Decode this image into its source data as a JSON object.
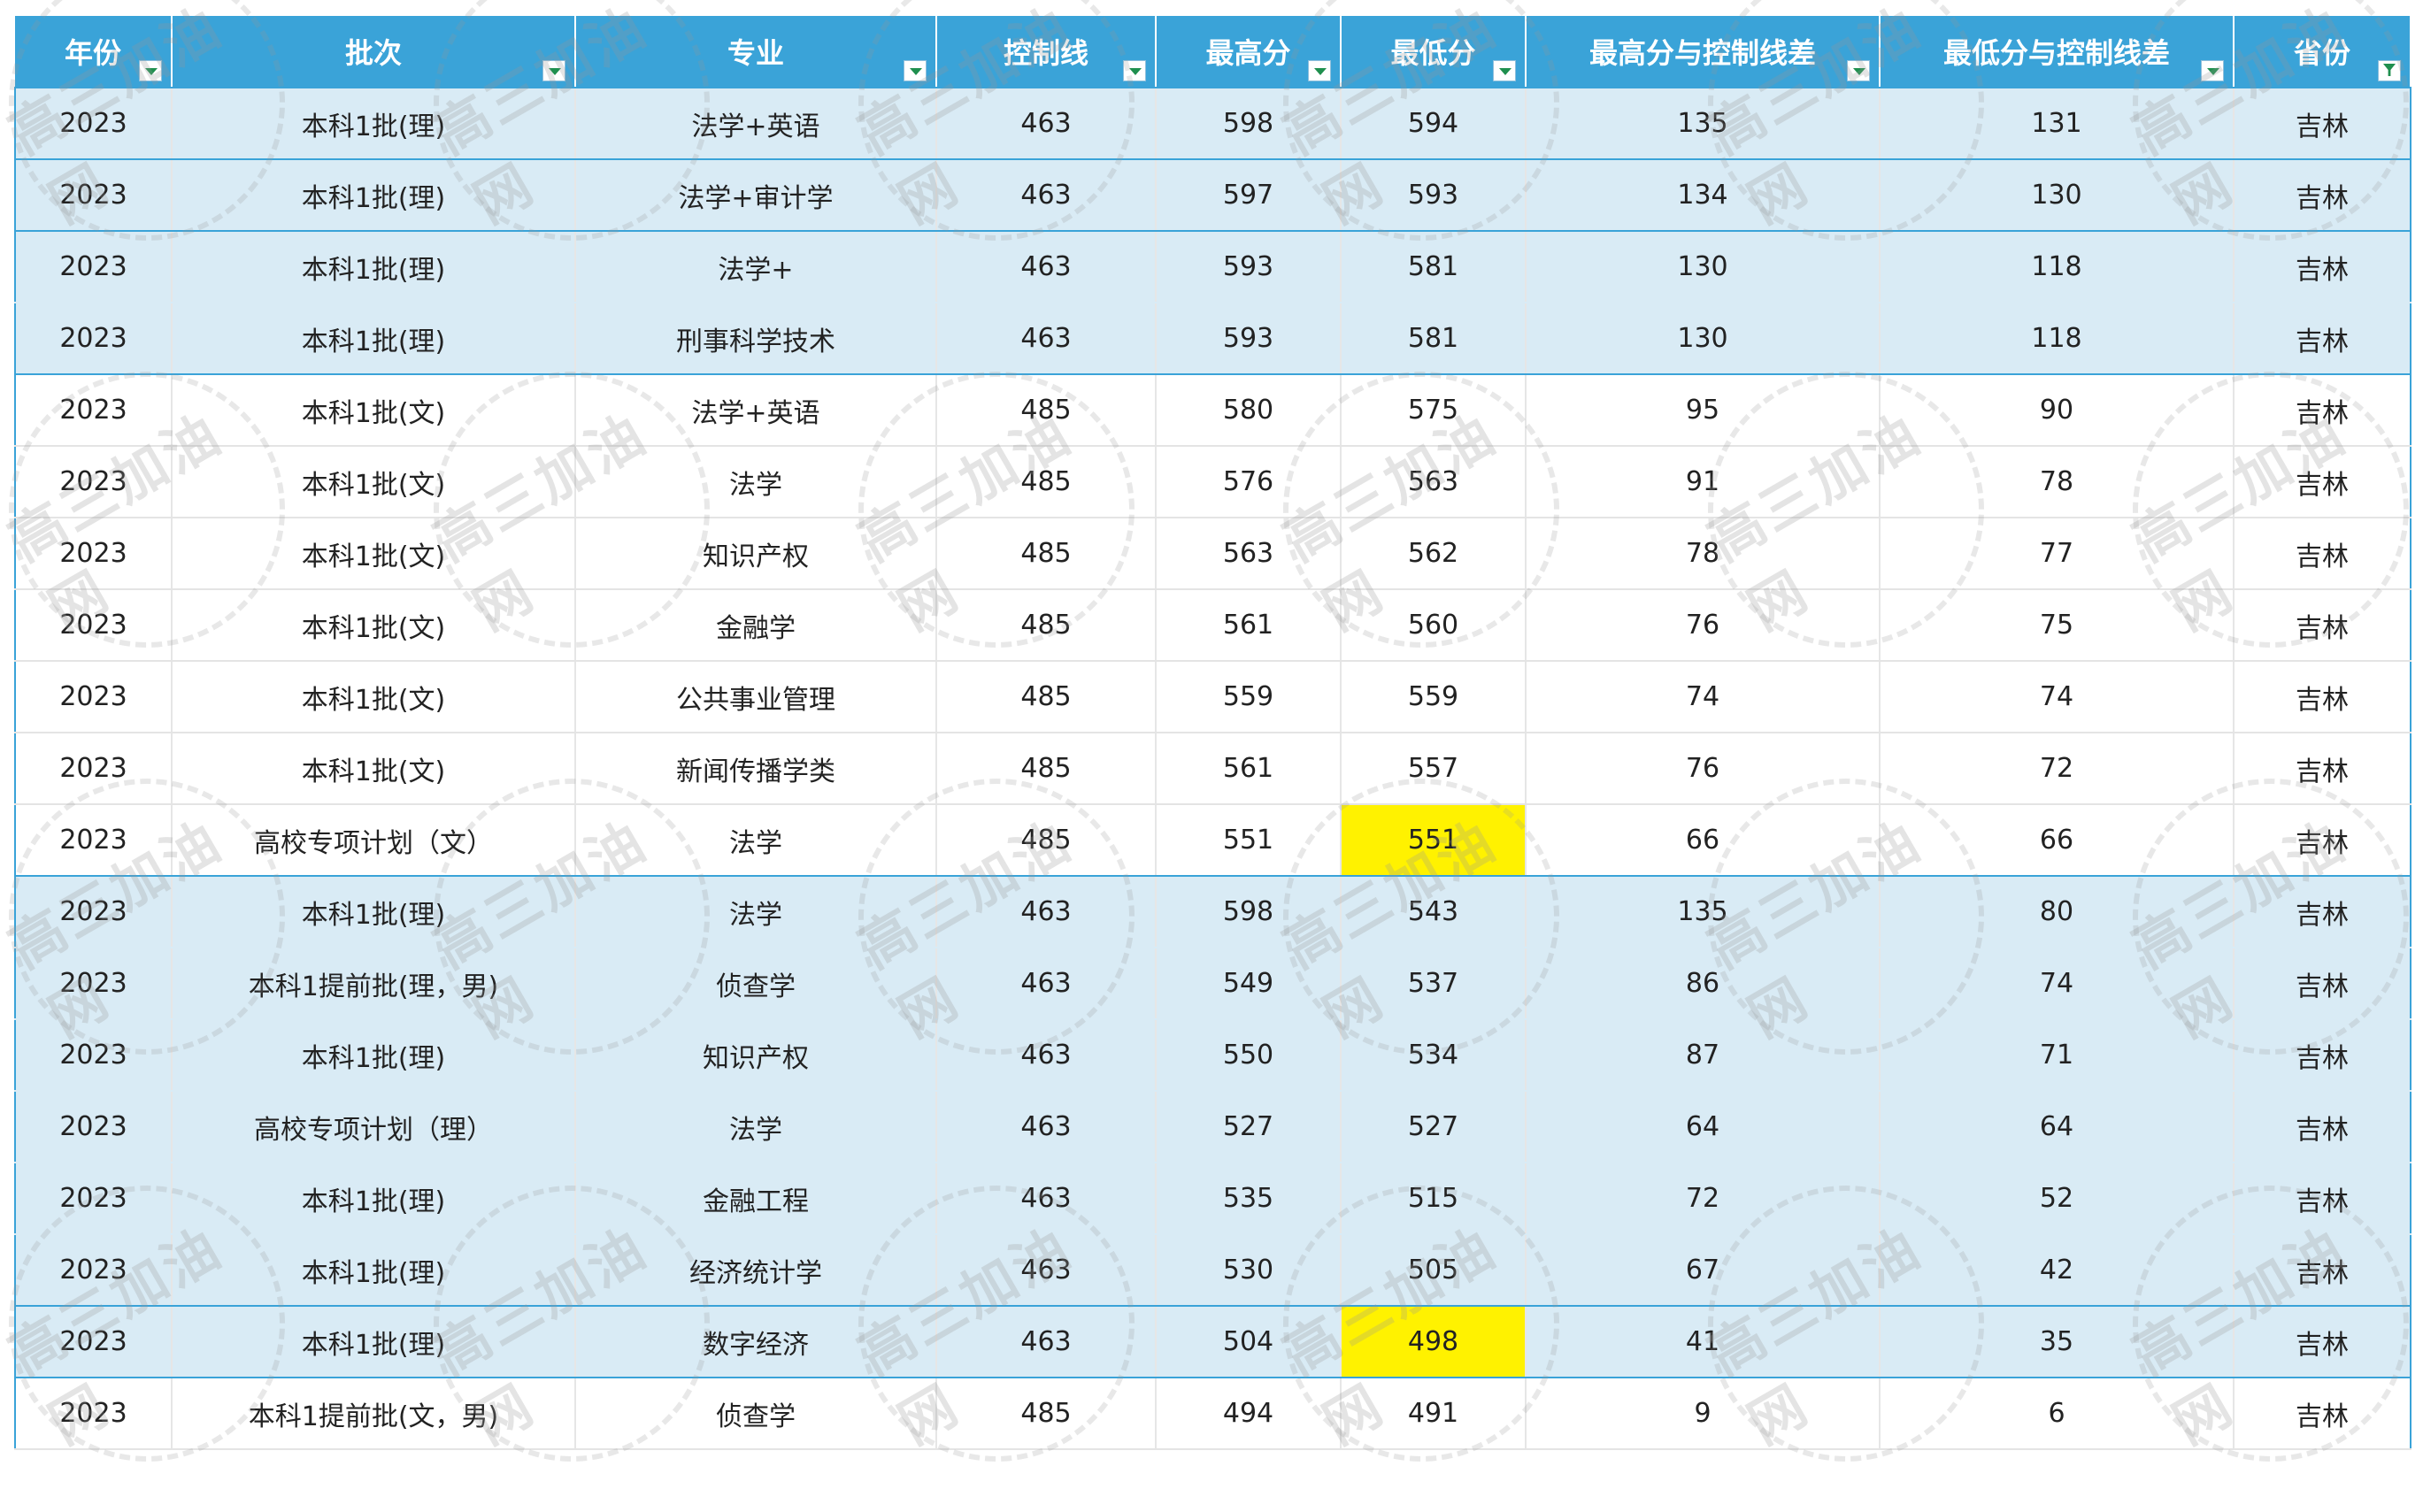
{
  "columns": [
    "年份",
    "批次",
    "专业",
    "控制线",
    "最高分",
    "最低分",
    "最高分与控制线差",
    "最低分与控制线差",
    "省份"
  ],
  "rows": [
    [
      "2023",
      "本科1批(理)",
      "法学+英语",
      "463",
      "598",
      "594",
      "135",
      "131",
      "吉林"
    ],
    [
      "2023",
      "本科1批(理)",
      "法学+审计学",
      "463",
      "597",
      "593",
      "134",
      "130",
      "吉林"
    ],
    [
      "2023",
      "本科1批(理)",
      "法学+",
      "463",
      "593",
      "581",
      "130",
      "118",
      "吉林"
    ],
    [
      "2023",
      "本科1批(理)",
      "刑事科学技术",
      "463",
      "593",
      "581",
      "130",
      "118",
      "吉林"
    ],
    [
      "2023",
      "本科1批(文)",
      "法学+英语",
      "485",
      "580",
      "575",
      "95",
      "90",
      "吉林"
    ],
    [
      "2023",
      "本科1批(文)",
      "法学",
      "485",
      "576",
      "563",
      "91",
      "78",
      "吉林"
    ],
    [
      "2023",
      "本科1批(文)",
      "知识产权",
      "485",
      "563",
      "562",
      "78",
      "77",
      "吉林"
    ],
    [
      "2023",
      "本科1批(文)",
      "金融学",
      "485",
      "561",
      "560",
      "76",
      "75",
      "吉林"
    ],
    [
      "2023",
      "本科1批(文)",
      "公共事业管理",
      "485",
      "559",
      "559",
      "74",
      "74",
      "吉林"
    ],
    [
      "2023",
      "本科1批(文)",
      "新闻传播学类",
      "485",
      "561",
      "557",
      "76",
      "72",
      "吉林"
    ],
    [
      "2023",
      "高校专项计划（文）",
      "法学",
      "485",
      "551",
      "551",
      "66",
      "66",
      "吉林"
    ],
    [
      "2023",
      "本科1批(理)",
      "法学",
      "463",
      "598",
      "543",
      "135",
      "80",
      "吉林"
    ],
    [
      "2023",
      "本科1提前批(理，男)",
      "侦查学",
      "463",
      "549",
      "537",
      "86",
      "74",
      "吉林"
    ],
    [
      "2023",
      "本科1批(理)",
      "知识产权",
      "463",
      "550",
      "534",
      "87",
      "71",
      "吉林"
    ],
    [
      "2023",
      "高校专项计划（理）",
      "法学",
      "463",
      "527",
      "527",
      "64",
      "64",
      "吉林"
    ],
    [
      "2023",
      "本科1批(理)",
      "金融工程",
      "463",
      "535",
      "515",
      "72",
      "52",
      "吉林"
    ],
    [
      "2023",
      "本科1批(理)",
      "经济统计学",
      "463",
      "530",
      "505",
      "67",
      "42",
      "吉林"
    ],
    [
      "2023",
      "本科1批(理)",
      "数字经济",
      "463",
      "504",
      "498",
      "41",
      "35",
      "吉林"
    ],
    [
      "2023",
      "本科1提前批(文，男)",
      "侦查学",
      "485",
      "494",
      "491",
      "9",
      "6",
      "吉林"
    ]
  ],
  "row_styles": [
    "band sep",
    "band sep",
    "band",
    "band sep",
    "plain",
    "plain",
    "plain",
    "plain",
    "plain",
    "plain",
    "plain sep",
    "band",
    "band",
    "band",
    "band",
    "band",
    "band sep",
    "band sep",
    "plain"
  ],
  "highlighted_cells": [
    [
      10,
      5
    ],
    [
      17,
      5
    ]
  ],
  "colors": {
    "header_bg": "#3aa3d8",
    "band_bg": "#d9ebf5",
    "highlight": "#fff200"
  },
  "filter_icons": [
    "filter-dropdown-icon",
    "filter-active-icon"
  ],
  "watermark_text": "高三加油网"
}
